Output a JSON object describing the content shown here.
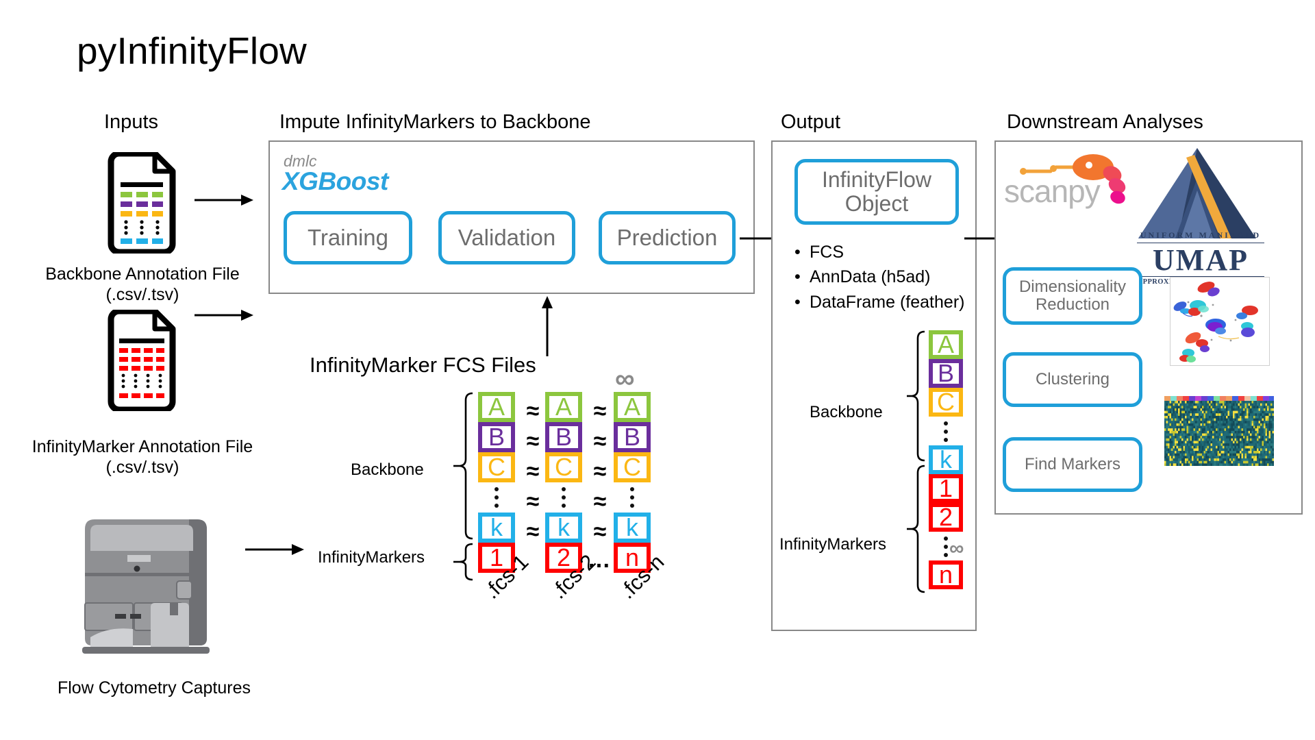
{
  "title": "pyInfinityFlow",
  "sections": {
    "inputs": {
      "heading": "Inputs",
      "file1_label_line1": "Backbone Annotation File",
      "file1_label_line2": "(.csv/.tsv)",
      "file2_label_line1": "InfinityMarker Annotation File",
      "file2_label_line2": "(.csv/.tsv)",
      "instrument_label": "Flow Cytometry Captures"
    },
    "impute": {
      "heading": "Impute InfinityMarkers to Backbone",
      "logo_top": "dmlc",
      "logo_main": "XGBoost",
      "steps": [
        "Training",
        "Validation",
        "Prediction"
      ]
    },
    "fcs": {
      "heading": "InfinityMarker FCS Files",
      "backbone_label": "Backbone",
      "infinitymarkers_label": "InfinityMarkers",
      "infinity_symbol": "∞",
      "approx_symbol": "≈",
      "ellipsis": "…",
      "backbone_rows": [
        "A",
        "B",
        "C",
        "⋮",
        "k"
      ],
      "marker_row": [
        "1",
        "2",
        "…",
        "n"
      ],
      "file_labels": [
        ".fcs-1",
        ".fcs-2",
        ".fcs-n"
      ]
    },
    "output": {
      "heading": "Output",
      "object_line1": "InfinityFlow",
      "object_line2": "Object",
      "formats": [
        "FCS",
        "AnnData (h5ad)",
        "DataFrame (feather)"
      ],
      "backbone_label": "Backbone",
      "infinitymarkers_label": "InfinityMarkers",
      "backbone_rows": [
        "A",
        "B",
        "C",
        "⋮",
        "k"
      ],
      "marker_rows": [
        "1",
        "2",
        "⋮",
        "n"
      ],
      "infinity_symbol": "∞"
    },
    "downstream": {
      "heading": "Downstream Analyses",
      "scanpy_logo_text": "scanpy",
      "umap_logo": {
        "top_text": "UNIFORM  MANIFOLD",
        "main_text": "UMAP",
        "bottom_text": "APPROXIMATION & PROJECTION"
      },
      "buttons": [
        "Dimensionality Reduction",
        "Clustering",
        "Find Markers"
      ],
      "thumbnails": [
        "umap-scatter-plot",
        "expression-heatmap"
      ]
    }
  },
  "colors": {
    "marker_a": "#8cc63e",
    "marker_b": "#6a2e9c",
    "marker_c": "#fbb713",
    "marker_k": "#22b0e8",
    "marker_n": "#ff0000",
    "accent_blue": "#1f9fd9",
    "xgboost_blue": "#2ba3de",
    "panel_border": "#888888",
    "text_gray": "#6d6d6d",
    "umap_navy": "#2b3f63",
    "scanpy_gray": "#b6b6b6"
  }
}
